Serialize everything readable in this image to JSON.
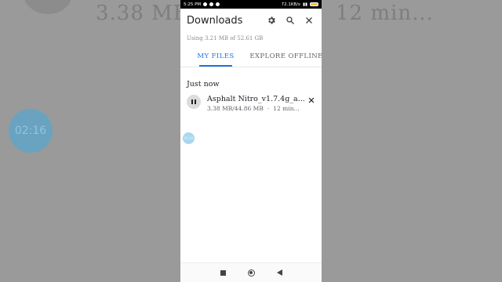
{
  "background": {
    "size_echo": "3.38 MB",
    "eta_echo": "12 min...",
    "timer": "02:16"
  },
  "status_bar": {
    "time": "5:25 PM",
    "network_speed": "72.1KB/s",
    "battery_color": "#f0c040"
  },
  "app_bar": {
    "title": "Downloads",
    "icons": [
      "gear-icon",
      "search-icon",
      "close-icon"
    ]
  },
  "storage_text": "Using 3.21 MB of 52.61 GB",
  "tabs": [
    {
      "label": "MY FILES",
      "active": true
    },
    {
      "label": "EXPLORE OFFLINE",
      "active": false
    }
  ],
  "accent_color": "#1a73e8",
  "section_header": "Just now",
  "downloads": [
    {
      "name": "Asphalt Nitro_v1.7.4g_a...",
      "progress_text": "3.38 MB/44.86 MB",
      "separator": "·",
      "eta": "12 min..."
    }
  ],
  "floating_bubble": "02:16",
  "nav_bar": {
    "buttons": [
      "recents-button",
      "home-button",
      "back-button"
    ]
  }
}
